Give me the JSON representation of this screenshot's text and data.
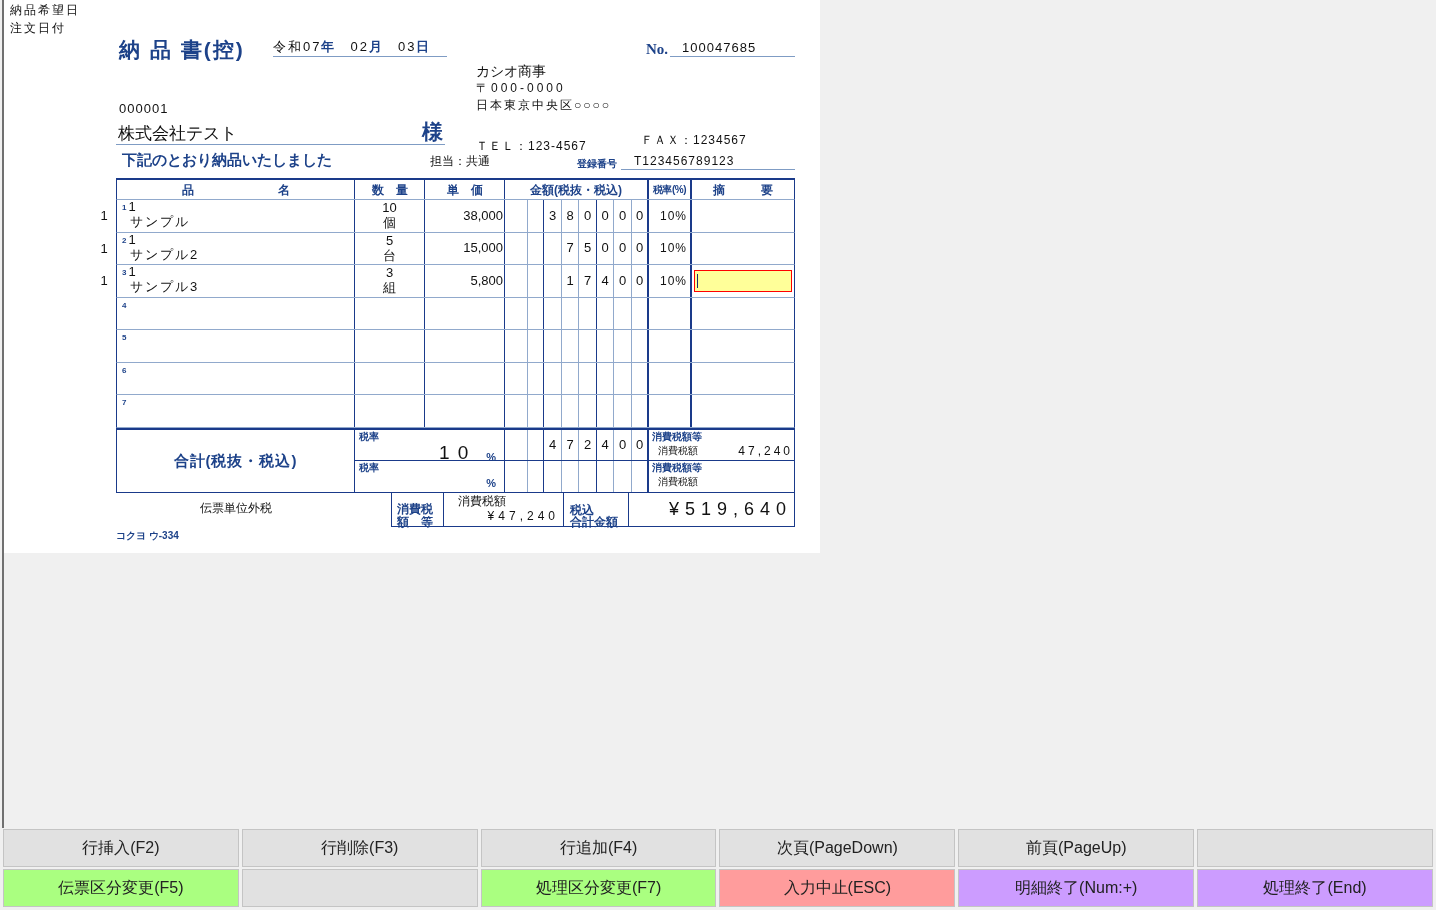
{
  "side_labels": [
    "納品希望日",
    "注文日付"
  ],
  "document": {
    "title": "納 品 書(控)",
    "date": {
      "era": "令和",
      "year": "07",
      "year_unit": "年",
      "month": "02",
      "month_unit": "月",
      "day": "03",
      "day_unit": "日"
    },
    "number_label": "No.",
    "number": "100047685",
    "customer": {
      "code": "000001",
      "name": "株式会社テスト",
      "honorific": "様"
    },
    "supplier": {
      "name": "カシオ商事",
      "postal": "〒000-0000",
      "address": "日本東京中央区○○○○",
      "tel": "ＴＥＬ：123-4567",
      "fax": "ＦＡＸ：1234567"
    },
    "message": "下記のとおり納品いたしました",
    "staff": "担当：共通",
    "registration": {
      "label": "登録番号",
      "number": "T123456789123"
    },
    "table": {
      "columns": [
        "品　　　　　　　名",
        "数　量",
        "単　価",
        "金額(税抜・税込)",
        "税率(%)",
        "摘　　　要"
      ],
      "rows": [
        {
          "line": "1",
          "side_mark": "1",
          "code": "1",
          "name": "サンプル",
          "quantity": "10",
          "unit": "個",
          "unit_price": "38,000",
          "amount_digits": [
            "3",
            "8",
            "0",
            "0",
            "0",
            "0"
          ],
          "tax_rate": "10%",
          "editing": false
        },
        {
          "line": "2",
          "side_mark": "1",
          "code": "1",
          "name": "サンプル2",
          "quantity": "5",
          "unit": "台",
          "unit_price": "15,000",
          "amount_digits": [
            "7",
            "5",
            "0",
            "0",
            "0"
          ],
          "tax_rate": "10%",
          "editing": false
        },
        {
          "line": "3",
          "side_mark": "1",
          "code": "1",
          "name": "サンプル3",
          "quantity": "3",
          "unit": "組",
          "unit_price": "5,800",
          "amount_digits": [
            "1",
            "7",
            "4",
            "0",
            "0"
          ],
          "tax_rate": "10%",
          "editing": true
        },
        {
          "line": "4",
          "editing": false
        },
        {
          "line": "5",
          "editing": false
        },
        {
          "line": "6",
          "editing": false
        },
        {
          "line": "7",
          "editing": false
        }
      ]
    },
    "totals": {
      "label": "合計(税抜・税込)",
      "tax_lines": [
        {
          "rate_label": "税率",
          "rate": "10",
          "percent_sign": "%",
          "amount_digits": [
            "4",
            "7",
            "2",
            "4",
            "0",
            "0"
          ],
          "tax_label": "消費税額等",
          "tax_sub_label": "消費税額",
          "tax_amount": "47,240"
        },
        {
          "rate_label": "税率",
          "percent_sign": "%",
          "tax_label": "消費税額等",
          "tax_sub_label": "消費税額"
        }
      ]
    },
    "tax_method": "伝票単位外税",
    "summary": {
      "tax_label_lines": [
        "消費税",
        "額等"
      ],
      "tax_sub_label": "消費税額",
      "tax_amount": "¥47,240",
      "total_label_lines": [
        "税込",
        "合計金額"
      ],
      "total_amount": "¥519,640"
    },
    "form_code": "コクヨ ウ-334"
  },
  "function_keys": [
    [
      {
        "label": "行挿入(F2)",
        "color": "#e1e1e1"
      },
      {
        "label": "行削除(F3)",
        "color": "#e1e1e1"
      },
      {
        "label": "行追加(F4)",
        "color": "#e1e1e1"
      },
      {
        "label": "次頁(PageDown)",
        "color": "#e1e1e1"
      },
      {
        "label": "前頁(PageUp)",
        "color": "#e1e1e1"
      },
      {
        "color": "#e1e1e1"
      }
    ],
    [
      {
        "label": "伝票区分変更(F5)",
        "color": "#aaff80"
      },
      {
        "color": "#e1e1e1"
      },
      {
        "label": "処理区分変更(F7)",
        "color": "#aaff80"
      },
      {
        "label": "入力中止(ESC)",
        "color": "#ff9c9c"
      },
      {
        "label": "明細終了(Num:+)",
        "color": "#cc9cff"
      },
      {
        "label": "処理終了(End)",
        "color": "#cc9cff"
      }
    ]
  ]
}
